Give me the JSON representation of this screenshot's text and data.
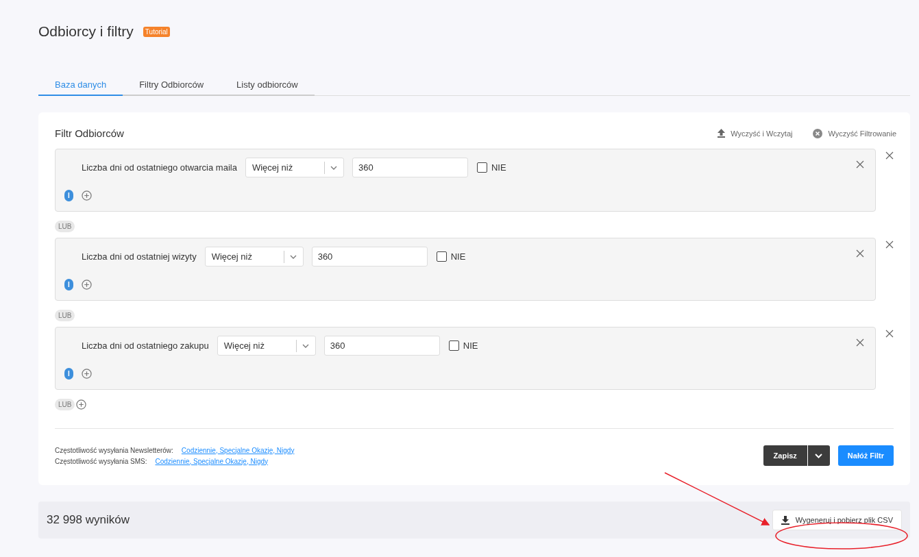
{
  "title": "Odbiorcy i filtry",
  "badge": "Tutorial",
  "tabs": [
    {
      "label": "Baza danych",
      "selected": true
    },
    {
      "label": "Filtry Odbiorców",
      "selected": false
    },
    {
      "label": "Listy odbiorców",
      "selected": false
    }
  ],
  "filter": {
    "title": "Filtr Odbiorców",
    "actions": [
      {
        "kind": "upload",
        "label": "Wyczyść i Wczytaj"
      },
      {
        "kind": "clear",
        "label": "Wyczyść Filtrowanie"
      }
    ],
    "conditions": [
      {
        "label": "Liczba dni od ostatniego otwarcia maila",
        "operator": "Więcej niż",
        "value": "360",
        "negate": {
          "label": "NIE",
          "checked": false
        },
        "and_badge": "I",
        "connector": "LUB"
      },
      {
        "label": "Liczba dni od ostatniej wizyty",
        "operator": "Więcej niż",
        "value": "360",
        "negate": {
          "label": "NIE",
          "checked": false
        },
        "and_badge": "I",
        "connector": "LUB"
      },
      {
        "label": "Liczba dni od ostatniego zakupu",
        "operator": "Więcej niż",
        "value": "360",
        "negate": {
          "label": "NIE",
          "checked": false
        },
        "and_badge": "I",
        "connector": "LUB"
      }
    ],
    "frequencies": [
      {
        "label": "Częstotliwość wysyłania Newsletterów:",
        "value": "Codziennie, Specjalne Okazje, Nigdy"
      },
      {
        "label": "Częstotliwość wysyłania SMS:",
        "value": "Codziennie, Specjalne Okazje, Nigdy"
      }
    ],
    "save_button": "Zapisz",
    "apply_button": "Nałóż Filtr"
  },
  "results": {
    "count": "32 998 wyników",
    "export_button": "Wygeneruj i pobierz plik CSV"
  }
}
